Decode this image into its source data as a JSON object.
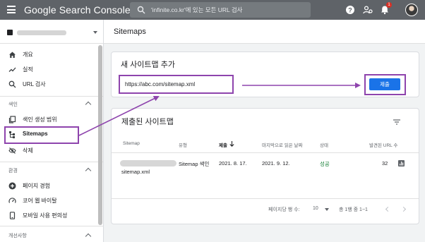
{
  "app": {
    "logo": "Google Search Console",
    "search_placeholder": "'infinite.co.kr'에 있는 모든 URL 검사",
    "notification_count": "1"
  },
  "sidebar": {
    "items_main": [
      {
        "label": "개요",
        "icon": "home-icon"
      },
      {
        "label": "실적",
        "icon": "trending-up-icon"
      },
      {
        "label": "URL 검사",
        "icon": "search-icon"
      }
    ],
    "section_index": "색인",
    "items_index": [
      {
        "label": "색인 생성 범위",
        "icon": "file-copy-icon"
      },
      {
        "label": "Sitemaps",
        "icon": "sitemap-icon"
      },
      {
        "label": "삭제",
        "icon": "eye-off-icon"
      }
    ],
    "section_experience": "환경",
    "items_experience": [
      {
        "label": "페이지 경험",
        "icon": "plus-circle-icon"
      },
      {
        "label": "코어 웹 바이탈",
        "icon": "speed-icon"
      },
      {
        "label": "모바일 사용 편의성",
        "icon": "phone-icon"
      }
    ],
    "section_enhancements": "개선사항"
  },
  "main": {
    "page_title": "Sitemaps",
    "add_card": {
      "title": "새 사이트맵 추가",
      "url_value": "https://abc.com/sitemap.xml",
      "submit_label": "제출"
    },
    "submitted_card": {
      "title": "제출된 사이트맵",
      "columns": [
        "Sitemap",
        "유형",
        "제출",
        "마지막으로 읽은 날짜",
        "상태",
        "발견된 URL 수"
      ],
      "row": {
        "sitemap": "sitemap.xml",
        "type": "Sitemap 색인",
        "submitted": "2021. 8. 17.",
        "last_read": "2021. 9. 12.",
        "status": "성공",
        "discovered_urls": "32"
      },
      "rows_per_page_label": "페이지당 행 수:",
      "rows_per_page_value": "10",
      "range_text": "총 1행 중 1~1"
    }
  },
  "colors": {
    "topbar": "#5f6368",
    "accent": "#1a73e8",
    "annotation": "#8e44ad",
    "success": "#188038"
  }
}
